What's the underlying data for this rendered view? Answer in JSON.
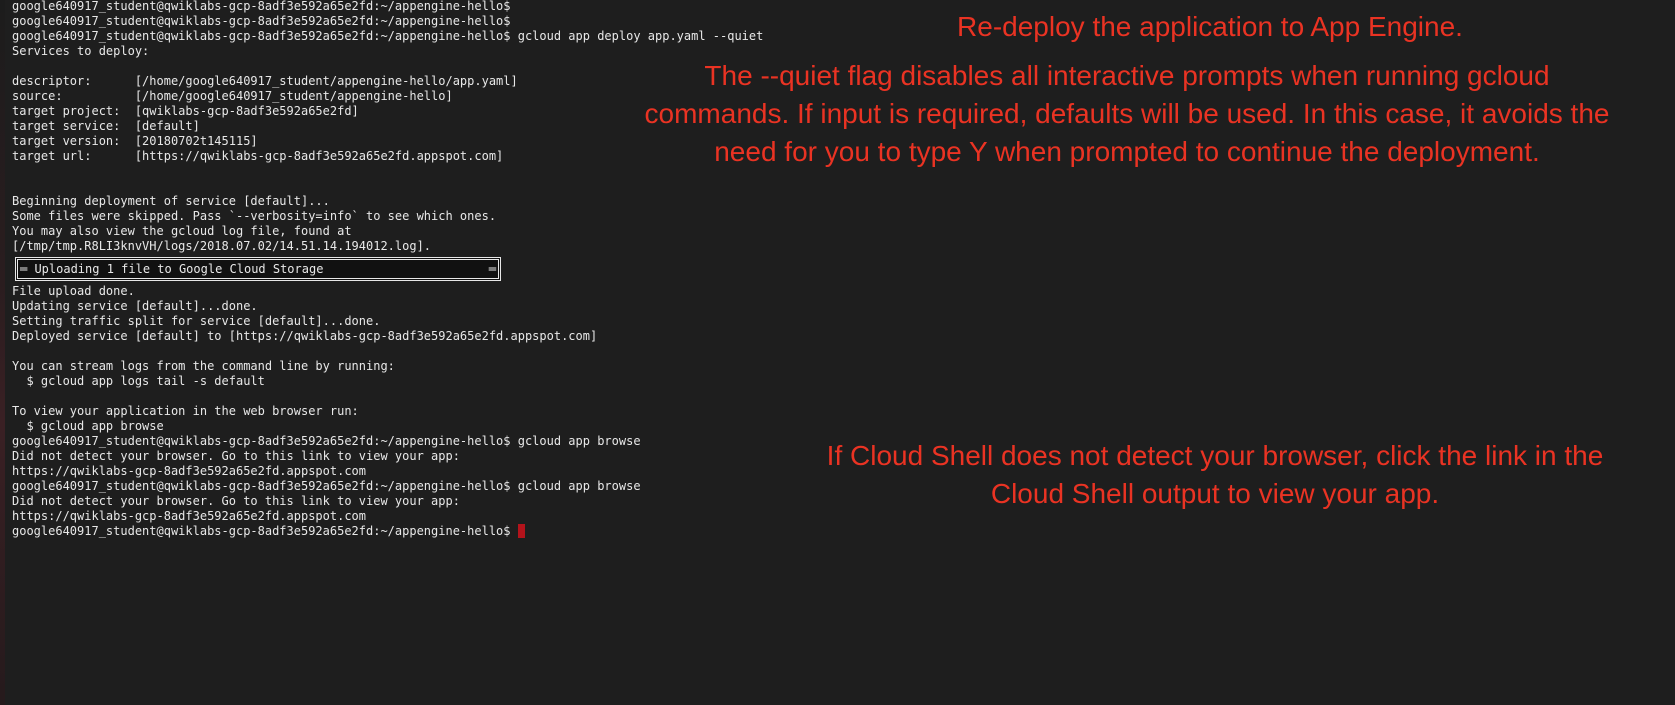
{
  "terminal": {
    "lines_top": [
      "google640917_student@qwiklabs-gcp-8adf3e592a65e2fd:~/appengine-hello$",
      "google640917_student@qwiklabs-gcp-8adf3e592a65e2fd:~/appengine-hello$",
      "google640917_student@qwiklabs-gcp-8adf3e592a65e2fd:~/appengine-hello$ gcloud app deploy app.yaml --quiet",
      "Services to deploy:",
      "",
      "descriptor:      [/home/google640917_student/appengine-hello/app.yaml]",
      "source:          [/home/google640917_student/appengine-hello]",
      "target project:  [qwiklabs-gcp-8adf3e592a65e2fd]",
      "target service:  [default]",
      "target version:  [20180702t145115]",
      "target url:      [https://qwiklabs-gcp-8adf3e592a65e2fd.appspot.com]",
      "",
      "",
      "Beginning deployment of service [default]...",
      "Some files were skipped. Pass `--verbosity=info` to see which ones.",
      "You may also view the gcloud log file, found at",
      "[/tmp/tmp.R8LI3knvVH/logs/2018.07.02/14.51.14.194012.log]."
    ],
    "upload_box": {
      "text": "═ Uploading 1 file to Google Cloud Storage",
      "end": "═"
    },
    "lines_bottom": [
      "File upload done.",
      "Updating service [default]...done.",
      "Setting traffic split for service [default]...done.",
      "Deployed service [default] to [https://qwiklabs-gcp-8adf3e592a65e2fd.appspot.com]",
      "",
      "You can stream logs from the command line by running:",
      "  $ gcloud app logs tail -s default",
      "",
      "To view your application in the web browser run:",
      "  $ gcloud app browse",
      "google640917_student@qwiklabs-gcp-8adf3e592a65e2fd:~/appengine-hello$ gcloud app browse",
      "Did not detect your browser. Go to this link to view your app:",
      "https://qwiklabs-gcp-8adf3e592a65e2fd.appspot.com",
      "google640917_student@qwiklabs-gcp-8adf3e592a65e2fd:~/appengine-hello$ gcloud app browse",
      "Did not detect your browser. Go to this link to view your app:",
      "https://qwiklabs-gcp-8adf3e592a65e2fd.appspot.com"
    ],
    "final_prompt": "google640917_student@qwiklabs-gcp-8adf3e592a65e2fd:~/appengine-hello$"
  },
  "annotations": {
    "redeploy": "Re-deploy the application to App Engine.",
    "quiet_flag": "The --quiet flag disables all interactive prompts when running gcloud commands. If input is required, defaults will be used. In this case, it avoids the need for you to type Y when prompted to continue the deployment.",
    "browser_link": "If Cloud Shell does not detect your browser, click the link in the Cloud Shell output to view your app."
  },
  "colors": {
    "background": "#1e1e1e",
    "terminal_text": "#e8e8e8",
    "annotation_text": "#ea3323",
    "cursor": "#b3131b"
  }
}
